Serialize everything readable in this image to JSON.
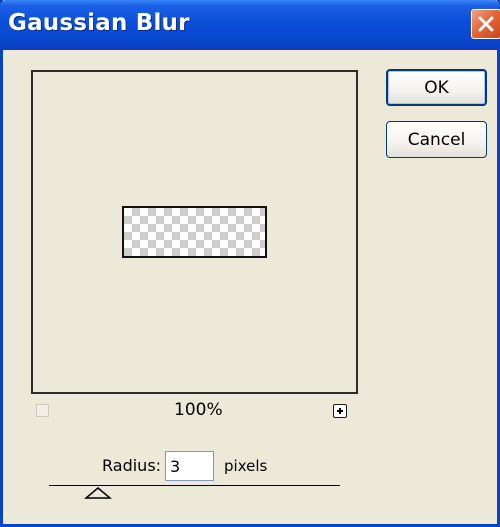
{
  "window": {
    "title": "Gaussian Blur",
    "title_bar_color": "#0a4fd6",
    "close_icon": "close-icon"
  },
  "buttons": {
    "ok_label": "OK",
    "cancel_label": "Cancel"
  },
  "preview": {
    "zoom_level": "100%",
    "zoom_out_icon": "minus-icon",
    "zoom_in_icon": "plus-icon"
  },
  "radius": {
    "label": "Radius:",
    "value": "3",
    "units": "pixels"
  }
}
